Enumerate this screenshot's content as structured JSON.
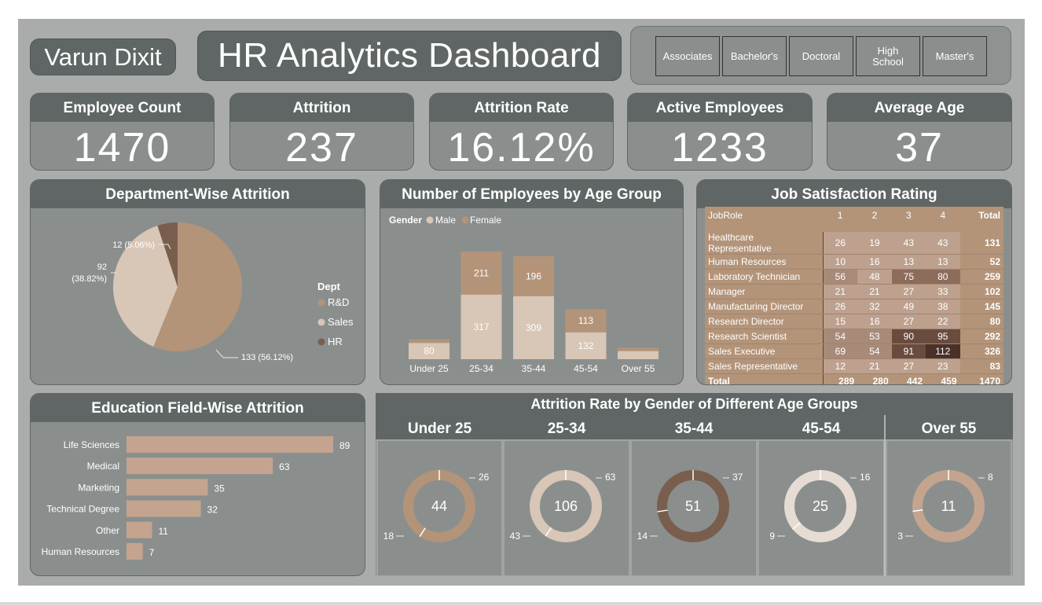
{
  "header": {
    "author": "Varun Dixit",
    "title": "HR Analytics Dashboard"
  },
  "education_slicer": [
    "Associates",
    "Bachelor's",
    "Doctoral",
    "High School",
    "Master's"
  ],
  "kpis": [
    {
      "label": "Employee Count",
      "value": "1470"
    },
    {
      "label": "Attrition",
      "value": "237"
    },
    {
      "label": "Attrition Rate",
      "value": "16.12%"
    },
    {
      "label": "Active Employees",
      "value": "1233"
    },
    {
      "label": "Average Age",
      "value": "37"
    }
  ],
  "colors": {
    "background": "#a9acab",
    "panel": "#8a8f8e",
    "header": "#5f6665",
    "rnd": "#b39479",
    "sales": "#d8c6b6",
    "hr": "#7a5e4d",
    "male": "#b39479",
    "female": "#d8c6b6",
    "bar": "#c4a48f"
  },
  "dept_chart": {
    "title": "Department-Wise Attrition",
    "legend_title": "Dept",
    "chart_data": {
      "type": "pie",
      "categories": [
        "R&D",
        "Sales",
        "HR"
      ],
      "values": [
        133,
        92,
        12
      ],
      "labels": [
        "133 (56.12%)",
        "92 (38.82%)",
        "12 (5.06%)"
      ]
    }
  },
  "age_chart": {
    "title": "Number of Employees by Age Group",
    "legend_title": "Gender",
    "chart_data": {
      "type": "bar",
      "categories": [
        "Under 25",
        "25-34",
        "35-44",
        "45-54",
        "Over 55"
      ],
      "series": [
        {
          "name": "Male",
          "values": [
            18,
            211,
            196,
            113,
            16
          ]
        },
        {
          "name": "Female",
          "values": [
            80,
            317,
            309,
            132,
            40
          ]
        }
      ],
      "shown_labels": {
        "Male": [
          "",
          "211",
          "196",
          "113",
          ""
        ],
        "Female": [
          "80",
          "317",
          "309",
          "132",
          ""
        ]
      }
    }
  },
  "job_satisfaction": {
    "title": "Job Satisfaction Rating",
    "columns": [
      "JobRole",
      "1",
      "2",
      "3",
      "4",
      "Total"
    ],
    "rows": [
      [
        "Healthcare Representative",
        "26",
        "19",
        "43",
        "43",
        "131"
      ],
      [
        "Human Resources",
        "10",
        "16",
        "13",
        "13",
        "52"
      ],
      [
        "Laboratory Technician",
        "56",
        "48",
        "75",
        "80",
        "259"
      ],
      [
        "Manager",
        "21",
        "21",
        "27",
        "33",
        "102"
      ],
      [
        "Manufacturing Director",
        "26",
        "32",
        "49",
        "38",
        "145"
      ],
      [
        "Research Director",
        "15",
        "16",
        "27",
        "22",
        "80"
      ],
      [
        "Research Scientist",
        "54",
        "53",
        "90",
        "95",
        "292"
      ],
      [
        "Sales Executive",
        "69",
        "54",
        "91",
        "112",
        "326"
      ],
      [
        "Sales Representative",
        "12",
        "21",
        "27",
        "23",
        "83"
      ]
    ],
    "total_row": [
      "Total",
      "289",
      "280",
      "442",
      "459",
      "1470"
    ]
  },
  "edu_chart": {
    "title": "Education Field-Wise Attrition",
    "chart_data": {
      "type": "bar",
      "categories": [
        "Life Sciences",
        "Medical",
        "Marketing",
        "Technical Degree",
        "Other",
        "Human Resources"
      ],
      "values": [
        89,
        63,
        35,
        32,
        11,
        7
      ]
    }
  },
  "gender_gauges": {
    "title": "Attrition Rate by Gender of Different Age Groups",
    "chart_data": {
      "type": "pie",
      "groups": [
        {
          "label": "Under 25",
          "total": 44,
          "male": 26,
          "female": 18,
          "color": "#b39479"
        },
        {
          "label": "25-34",
          "total": 106,
          "male": 63,
          "female": 43,
          "color": "#d8c6b6"
        },
        {
          "label": "35-44",
          "total": 51,
          "male": 37,
          "female": 14,
          "color": "#7a5e4d"
        },
        {
          "label": "45-54",
          "total": 25,
          "male": 16,
          "female": 9,
          "color": "#e6dcd4"
        },
        {
          "label": "Over 55",
          "total": 11,
          "male": 8,
          "female": 3,
          "color": "#c4a48f"
        }
      ]
    }
  }
}
